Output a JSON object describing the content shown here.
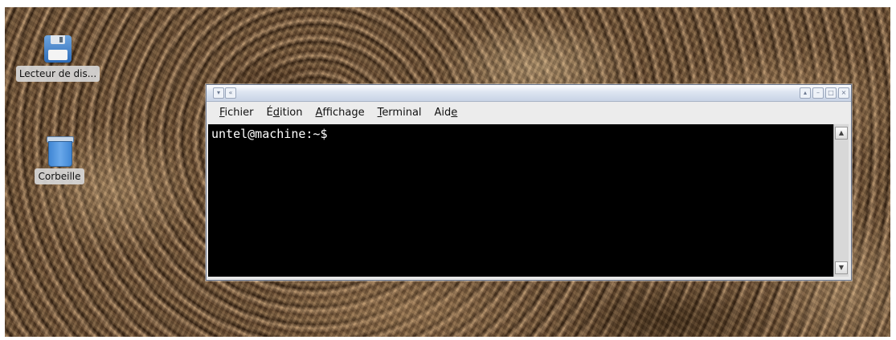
{
  "desktop": {
    "icons": [
      {
        "label": "Lecteur de dis...",
        "icon": "floppy-disk-icon"
      },
      {
        "label": "Corbeille",
        "icon": "trash-icon"
      }
    ]
  },
  "terminal": {
    "menu": {
      "fichier": {
        "accel": "F",
        "rest": "ichier"
      },
      "edition": {
        "pre": "É",
        "accel": "d",
        "rest": "ition"
      },
      "affichage": {
        "accel": "A",
        "rest": "ffichage"
      },
      "terminal": {
        "accel": "T",
        "rest": "erminal"
      },
      "aide": {
        "pre": "Aid",
        "accel": "e"
      }
    },
    "prompt": "untel@machine:~$ "
  }
}
